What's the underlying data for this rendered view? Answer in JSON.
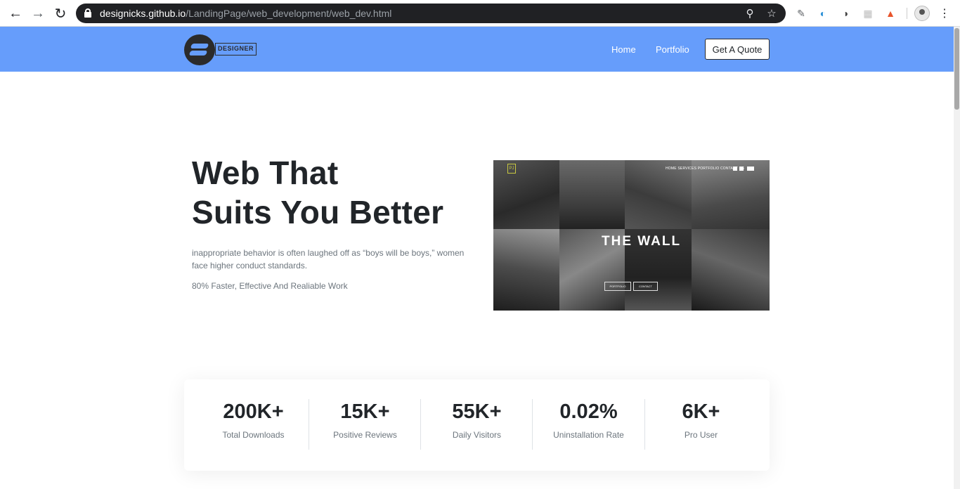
{
  "browser": {
    "url_host": "designicks.github.io",
    "url_path": "/LandingPage/web_development/web_dev.html"
  },
  "header": {
    "logo_text": "DESIGNER",
    "nav": [
      {
        "label": "Home"
      },
      {
        "label": "Portfolio"
      }
    ],
    "cta_label": "Get A Quote"
  },
  "hero": {
    "title_line1": "Web That",
    "title_line2": "Suits You Better",
    "description": "inappropriate behavior is often laughed off as “boys will be boys,” women face higher conduct standards.",
    "subtext": "80% Faster, Effective And Realiable Work"
  },
  "preview": {
    "nav": "HOME  SERVICES  PORTFOLIO  CONTACT US",
    "title": "THE WALL",
    "btn1": "PORTFOLIO",
    "btn2": "CONTACT",
    "logo": "PJ"
  },
  "stats": [
    {
      "value": "200K+",
      "label": "Total Downloads"
    },
    {
      "value": "15K+",
      "label": "Positive Reviews"
    },
    {
      "value": "55K+",
      "label": "Daily Visitors"
    },
    {
      "value": "0.02%",
      "label": "Uninstallation Rate"
    },
    {
      "value": "6K+",
      "label": "Pro User"
    }
  ],
  "colors": {
    "header_bg": "#669dfb",
    "text_dark": "#212529",
    "text_muted": "#6c757d"
  }
}
